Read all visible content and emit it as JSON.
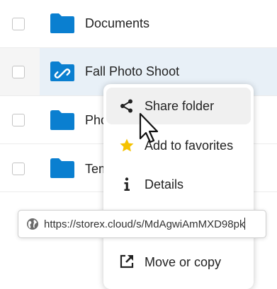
{
  "files": [
    {
      "name": "Documents",
      "icon": "folder-icon",
      "selected": false
    },
    {
      "name": "Fall Photo Shoot",
      "icon": "shared-folder-icon",
      "selected": true
    },
    {
      "name": "Pho",
      "icon": "folder-icon",
      "selected": false
    },
    {
      "name": "Tem",
      "icon": "folder-icon",
      "selected": false
    }
  ],
  "context_menu": {
    "items": [
      {
        "label": "Share folder",
        "icon": "share-icon"
      },
      {
        "label": "Add to favorites",
        "icon": "star-icon"
      },
      {
        "label": "Details",
        "icon": "info-icon"
      },
      {
        "label": "Move or copy",
        "icon": "external-link-icon"
      }
    ]
  },
  "share_link": {
    "url": "https://storex.cloud/s/MdAgwiAmMXD98pk",
    "icon": "globe-icon"
  },
  "colors": {
    "folder_blue": "#0a7fd0",
    "star_yellow": "#f5c200",
    "selection_highlight": "#e8f0f7"
  }
}
